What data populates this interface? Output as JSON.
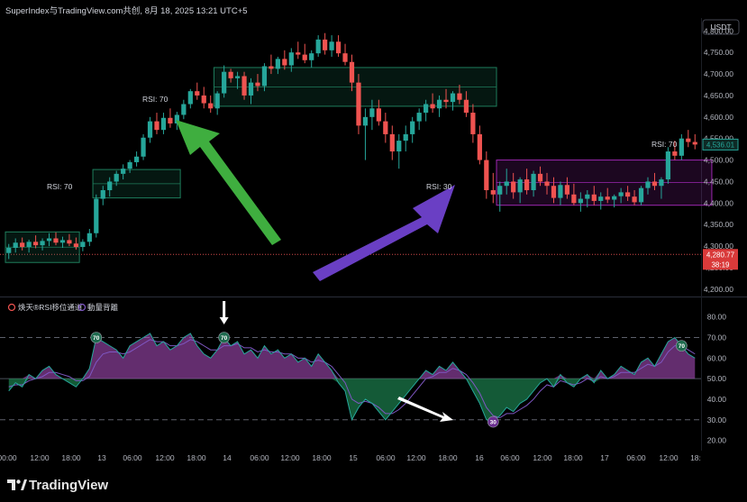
{
  "header": {
    "title": "SuperIndex与TradingView.com共创, 8月 18, 2025 13:21 UTC+5"
  },
  "price_axis": {
    "currency": "USDT",
    "ticks": [
      "4,800.00",
      "4,750.00",
      "4,700.00",
      "4,650.00",
      "4,600.00",
      "4,550.00",
      "4,500.00",
      "4,450.00",
      "4,400.00",
      "4,350.00",
      "4,300.00",
      "4,250.00",
      "4,200.00"
    ],
    "current_price": "4,536.01",
    "ref_price": "4,280.77",
    "countdown": "38:19"
  },
  "time_axis": {
    "ticks": [
      "00:00",
      "12:00",
      "18:00",
      "13",
      "06:00",
      "12:00",
      "18:00",
      "14",
      "06:00",
      "12:00",
      "18:00",
      "15",
      "06:00",
      "12:00",
      "18:00",
      "16",
      "06:00",
      "12:00",
      "18:00",
      "17",
      "06:00",
      "12:00",
      "18:"
    ]
  },
  "indicator": {
    "legend": "焕天®RSI移位通道",
    "legend2": "動量背離",
    "ticks": [
      "80.00",
      "70.00",
      "60.00",
      "50.00",
      "40.00",
      "30.00",
      "20.00"
    ],
    "levels": [
      70,
      50,
      30
    ]
  },
  "annotations": {
    "rsi_labels": [
      "RSI: 70",
      "RSI: 70",
      "RSI: 30",
      "RSI: 70"
    ],
    "markers": [
      "70",
      "70",
      "30",
      "70"
    ]
  },
  "colors": {
    "bull": "#26a69a",
    "bear": "#ef5350",
    "zone_green": "#1e7d5c",
    "zone_purple": "#9c27b0",
    "arrow_green": "#3fae3f",
    "arrow_purple": "#6a3fc4",
    "rsi_high": "#b452c8",
    "rsi_low": "#1f8a55"
  },
  "footer": {
    "brand": "TradingView"
  },
  "chart_data": {
    "type": "candlestick",
    "y_range": [
      4185,
      4830
    ],
    "rsi_range": [
      15,
      86
    ],
    "ohlc": [
      [
        4284,
        4305,
        4270,
        4296
      ],
      [
        4296,
        4318,
        4285,
        4308
      ],
      [
        4308,
        4320,
        4290,
        4298
      ],
      [
        4298,
        4315,
        4285,
        4310
      ],
      [
        4310,
        4325,
        4295,
        4302
      ],
      [
        4302,
        4318,
        4290,
        4312
      ],
      [
        4312,
        4330,
        4300,
        4318
      ],
      [
        4318,
        4332,
        4302,
        4308
      ],
      [
        4308,
        4322,
        4296,
        4314
      ],
      [
        4314,
        4328,
        4300,
        4306
      ],
      [
        4306,
        4320,
        4292,
        4298
      ],
      [
        4298,
        4316,
        4288,
        4310
      ],
      [
        4310,
        4340,
        4300,
        4330
      ],
      [
        4330,
        4420,
        4320,
        4410
      ],
      [
        4410,
        4440,
        4395,
        4430
      ],
      [
        4430,
        4460,
        4415,
        4450
      ],
      [
        4450,
        4475,
        4440,
        4468
      ],
      [
        4468,
        4490,
        4455,
        4480
      ],
      [
        4480,
        4500,
        4470,
        4495
      ],
      [
        4495,
        4520,
        4485,
        4508
      ],
      [
        4508,
        4560,
        4500,
        4552
      ],
      [
        4552,
        4600,
        4540,
        4590
      ],
      [
        4590,
        4610,
        4560,
        4570
      ],
      [
        4570,
        4610,
        4560,
        4598
      ],
      [
        4598,
        4620,
        4575,
        4585
      ],
      [
        4585,
        4612,
        4570,
        4605
      ],
      [
        4605,
        4640,
        4595,
        4630
      ],
      [
        4630,
        4665,
        4620,
        4660
      ],
      [
        4660,
        4680,
        4640,
        4650
      ],
      [
        4650,
        4670,
        4620,
        4632
      ],
      [
        4632,
        4650,
        4610,
        4620
      ],
      [
        4620,
        4660,
        4605,
        4655
      ],
      [
        4655,
        4720,
        4645,
        4705
      ],
      [
        4705,
        4712,
        4680,
        4690
      ],
      [
        4690,
        4705,
        4665,
        4695
      ],
      [
        4695,
        4705,
        4640,
        4650
      ],
      [
        4650,
        4690,
        4630,
        4680
      ],
      [
        4680,
        4700,
        4660,
        4672
      ],
      [
        4672,
        4725,
        4660,
        4718
      ],
      [
        4718,
        4745,
        4700,
        4712
      ],
      [
        4712,
        4740,
        4700,
        4735
      ],
      [
        4735,
        4755,
        4710,
        4720
      ],
      [
        4720,
        4760,
        4705,
        4750
      ],
      [
        4750,
        4775,
        4735,
        4745
      ],
      [
        4745,
        4770,
        4725,
        4732
      ],
      [
        4732,
        4755,
        4715,
        4748
      ],
      [
        4748,
        4790,
        4740,
        4780
      ],
      [
        4780,
        4795,
        4745,
        4755
      ],
      [
        4755,
        4790,
        4740,
        4775
      ],
      [
        4775,
        4790,
        4740,
        4748
      ],
      [
        4748,
        4770,
        4720,
        4728
      ],
      [
        4728,
        4745,
        4660,
        4680
      ],
      [
        4680,
        4700,
        4560,
        4580
      ],
      [
        4580,
        4620,
        4500,
        4600
      ],
      [
        4600,
        4640,
        4570,
        4620
      ],
      [
        4620,
        4640,
        4580,
        4590
      ],
      [
        4590,
        4610,
        4540,
        4560
      ],
      [
        4560,
        4580,
        4500,
        4520
      ],
      [
        4520,
        4560,
        4480,
        4545
      ],
      [
        4545,
        4580,
        4520,
        4560
      ],
      [
        4560,
        4600,
        4540,
        4590
      ],
      [
        4590,
        4620,
        4570,
        4610
      ],
      [
        4610,
        4640,
        4590,
        4630
      ],
      [
        4630,
        4655,
        4610,
        4620
      ],
      [
        4620,
        4650,
        4600,
        4640
      ],
      [
        4640,
        4665,
        4620,
        4635
      ],
      [
        4635,
        4660,
        4615,
        4655
      ],
      [
        4655,
        4675,
        4630,
        4640
      ],
      [
        4640,
        4660,
        4600,
        4610
      ],
      [
        4610,
        4630,
        4540,
        4560
      ],
      [
        4560,
        4580,
        4490,
        4500
      ],
      [
        4500,
        4520,
        4410,
        4430
      ],
      [
        4430,
        4470,
        4400,
        4420
      ],
      [
        4420,
        4450,
        4380,
        4440
      ],
      [
        4440,
        4480,
        4420,
        4450
      ],
      [
        4450,
        4470,
        4410,
        4425
      ],
      [
        4425,
        4460,
        4400,
        4455
      ],
      [
        4455,
        4480,
        4420,
        4430
      ],
      [
        4430,
        4475,
        4415,
        4468
      ],
      [
        4468,
        4485,
        4440,
        4450
      ],
      [
        4450,
        4470,
        4420,
        4440
      ],
      [
        4440,
        4460,
        4400,
        4412
      ],
      [
        4412,
        4450,
        4395,
        4442
      ],
      [
        4442,
        4460,
        4410,
        4420
      ],
      [
        4420,
        4445,
        4395,
        4400
      ],
      [
        4400,
        4425,
        4380,
        4410
      ],
      [
        4410,
        4430,
        4390,
        4420
      ],
      [
        4420,
        4440,
        4395,
        4405
      ],
      [
        4405,
        4425,
        4385,
        4415
      ],
      [
        4415,
        4435,
        4400,
        4408
      ],
      [
        4408,
        4420,
        4390,
        4416
      ],
      [
        4416,
        4435,
        4400,
        4425
      ],
      [
        4425,
        4440,
        4405,
        4415
      ],
      [
        4415,
        4430,
        4395,
        4402
      ],
      [
        4402,
        4440,
        4395,
        4435
      ],
      [
        4435,
        4460,
        4420,
        4450
      ],
      [
        4450,
        4470,
        4430,
        4440
      ],
      [
        4440,
        4460,
        4410,
        4455
      ],
      [
        4455,
        4530,
        4445,
        4520
      ],
      [
        4520,
        4545,
        4500,
        4510
      ],
      [
        4510,
        4560,
        4500,
        4550
      ],
      [
        4550,
        4570,
        4530,
        4542
      ],
      [
        4542,
        4560,
        4525,
        4536
      ]
    ],
    "rsi": [
      44,
      48,
      46,
      52,
      50,
      54,
      56,
      52,
      50,
      48,
      46,
      50,
      55,
      70,
      68,
      66,
      64,
      60,
      66,
      68,
      70,
      72,
      66,
      68,
      64,
      66,
      70,
      72,
      66,
      62,
      60,
      64,
      70,
      66,
      68,
      62,
      64,
      60,
      66,
      62,
      64,
      60,
      62,
      58,
      60,
      56,
      62,
      58,
      54,
      48,
      44,
      30,
      36,
      40,
      38,
      34,
      30,
      34,
      38,
      42,
      46,
      50,
      54,
      52,
      56,
      54,
      58,
      54,
      50,
      44,
      38,
      30,
      29,
      32,
      36,
      34,
      38,
      40,
      44,
      48,
      50,
      46,
      52,
      48,
      46,
      50,
      52,
      48,
      54,
      50,
      52,
      56,
      54,
      52,
      58,
      60,
      56,
      62,
      68,
      70,
      66,
      62,
      60
    ],
    "rsi_signal": [
      46,
      47,
      47,
      49,
      50,
      51,
      53,
      53,
      52,
      51,
      49,
      49,
      51,
      58,
      62,
      63,
      63,
      62,
      63,
      65,
      67,
      69,
      68,
      68,
      66,
      66,
      67,
      69,
      68,
      66,
      64,
      64,
      66,
      66,
      67,
      65,
      65,
      63,
      64,
      63,
      63,
      62,
      62,
      60,
      60,
      58,
      59,
      58,
      56,
      52,
      48,
      40,
      38,
      39,
      38,
      36,
      33,
      33,
      35,
      38,
      42,
      46,
      50,
      51,
      53,
      53,
      55,
      54,
      52,
      48,
      43,
      36,
      32,
      31,
      33,
      33,
      35,
      37,
      40,
      44,
      47,
      46,
      49,
      48,
      47,
      48,
      50,
      49,
      51,
      50,
      51,
      53,
      53,
      53,
      55,
      57,
      56,
      58,
      63,
      66,
      66,
      64,
      62
    ]
  }
}
